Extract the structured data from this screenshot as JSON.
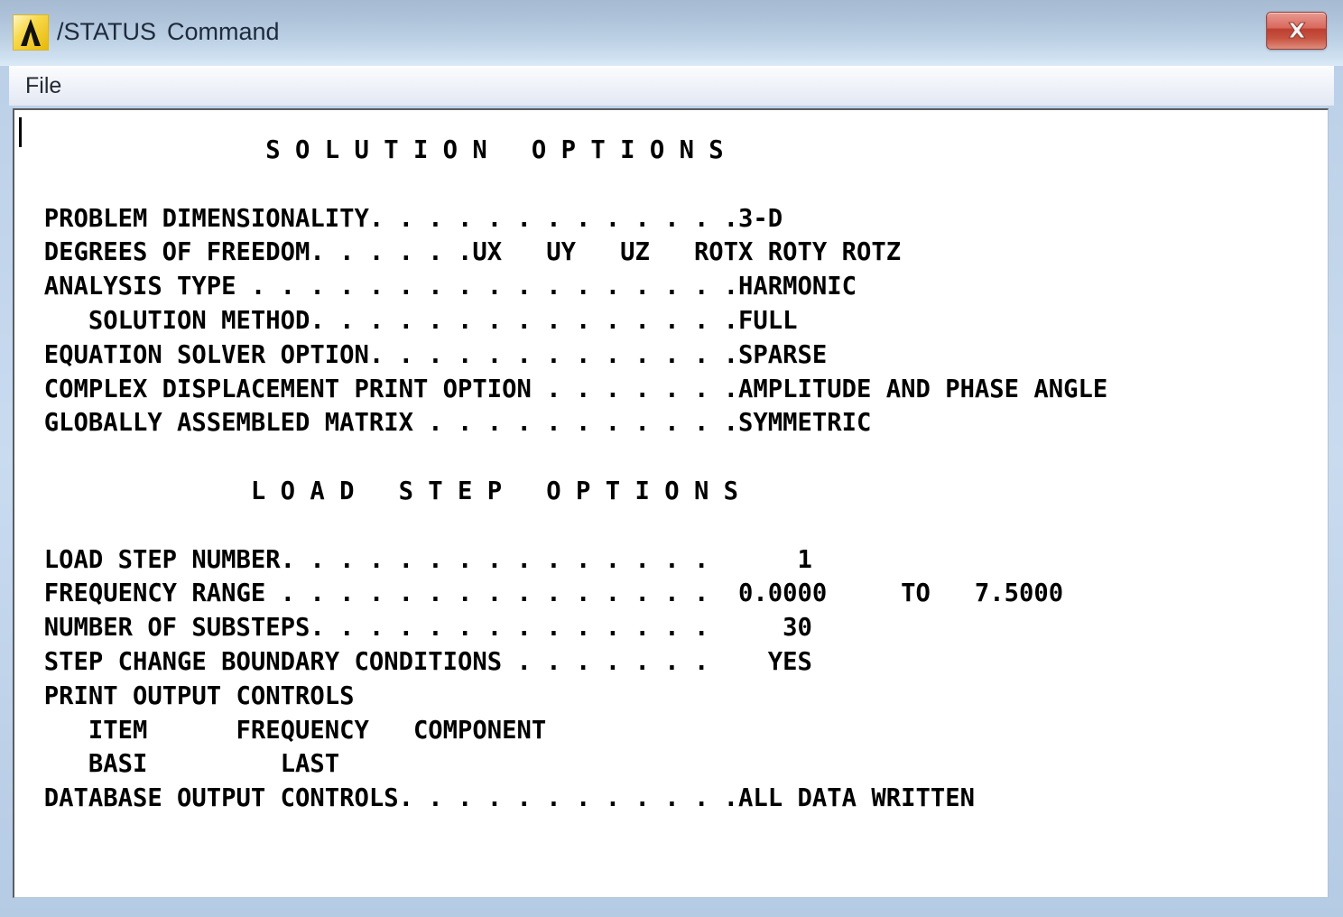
{
  "window": {
    "title_prefix": "/STATUS",
    "title_suffix": "Command",
    "logo_icon": "ansys-lambda-icon",
    "close_icon": "close-x-icon"
  },
  "menubar": {
    "items": [
      {
        "label": "File"
      }
    ]
  },
  "colors": {
    "titlebar_top": "#a6bad2",
    "titlebar_bottom": "#dceaf6",
    "frame": "#b9cee6",
    "close_button": "#bc3f31",
    "logo_gold": "#e8b806",
    "text": "#000000",
    "console_background": "#ffffff"
  },
  "console": {
    "sections": [
      {
        "heading": "S O L U T I O N     O P T I O N S",
        "rows": [
          {
            "label": "PROBLEM DIMENSIONALITY",
            "leader": ". . . . . . . . . . . . .",
            "value": "3-D",
            "indent": 0
          },
          {
            "label": "DEGREES OF FREEDOM",
            "leader": ". . . . . .",
            "value": "UX   UY   UZ   ROTX ROTY ROTZ",
            "indent": 0
          },
          {
            "label": "ANALYSIS TYPE",
            "leader": ". . . . . . . . . . . . . . . .",
            "value": "HARMONIC",
            "indent": 0
          },
          {
            "label": "SOLUTION METHOD",
            "leader": ". . . . . . . . . . . . .",
            "value": "FULL",
            "indent": 4
          },
          {
            "label": "EQUATION SOLVER OPTION",
            "leader": ". . . . . . . . . . . .",
            "value": "SPARSE",
            "indent": 0
          },
          {
            "label": "COMPLEX DISPLACEMENT PRINT OPTION",
            "leader": ". . . . . . .",
            "value": "AMPLITUDE AND PHASE ANGLE",
            "indent": 0
          },
          {
            "label": "GLOBALLY ASSEMBLED MATRIX",
            "leader": ". . . . . . . . . . .",
            "value": "SYMMETRIC",
            "indent": 0
          }
        ]
      },
      {
        "heading": "L O A D    S T E P    O P T I O N S",
        "rows": [
          {
            "label": "LOAD STEP NUMBER",
            "leader": ". . . . . . . . . . . . . . . .",
            "value": "1",
            "indent": 0
          },
          {
            "label": "FREQUENCY RANGE",
            "leader": ". . . . . . . . . . . . . . . .",
            "value": "0.0000     TO   7.5000",
            "indent": 0
          },
          {
            "label": "NUMBER OF SUBSTEPS",
            "leader": ". . . . . . . . . . . . . .",
            "value": "30",
            "indent": 0
          },
          {
            "label": "STEP CHANGE BOUNDARY CONDITIONS",
            "leader": ". . . . . . . .",
            "value": "YES",
            "indent": 0
          },
          {
            "label": "PRINT OUTPUT CONTROLS",
            "leader": "",
            "value": "",
            "indent": 0
          },
          {
            "label": "ITEM      FREQUENCY   COMPONENT",
            "leader": "",
            "value": "",
            "indent": 4
          },
          {
            "label": "BASI         LAST",
            "leader": "",
            "value": "",
            "indent": 4
          },
          {
            "label": "DATABASE OUTPUT CONTROLS",
            "leader": ". . . . . . . . . . . .",
            "value": "ALL DATA WRITTEN",
            "indent": 0
          }
        ]
      }
    ],
    "raw": [
      "                 S O L U T I O N   O P T I O N S",
      "",
      "  PROBLEM DIMENSIONALITY. . . . . . . . . . . . .3-D",
      "  DEGREES OF FREEDOM. . . . . .UX   UY   UZ   ROTX ROTY ROTZ",
      "  ANALYSIS TYPE . . . . . . . . . . . . . . . . .HARMONIC",
      "     SOLUTION METHOD. . . . . . . . . . . . . . .FULL",
      "  EQUATION SOLVER OPTION. . . . . . . . . . . . .SPARSE",
      "  COMPLEX DISPLACEMENT PRINT OPTION . . . . . . .AMPLITUDE AND PHASE ANGLE",
      "  GLOBALLY ASSEMBLED MATRIX . . . . . . . . . . .SYMMETRIC",
      "",
      "                L O A D   S T E P   O P T I O N S",
      "",
      "  LOAD STEP NUMBER. . . . . . . . . . . . . . .      1",
      "  FREQUENCY RANGE . . . . . . . . . . . . . . .  0.0000     TO   7.5000",
      "  NUMBER OF SUBSTEPS. . . . . . . . . . . . . .     30",
      "  STEP CHANGE BOUNDARY CONDITIONS . . . . . . .    YES",
      "  PRINT OUTPUT CONTROLS",
      "     ITEM      FREQUENCY   COMPONENT",
      "     BASI         LAST",
      "  DATABASE OUTPUT CONTROLS. . . . . . . . . . . .ALL DATA WRITTEN"
    ]
  }
}
